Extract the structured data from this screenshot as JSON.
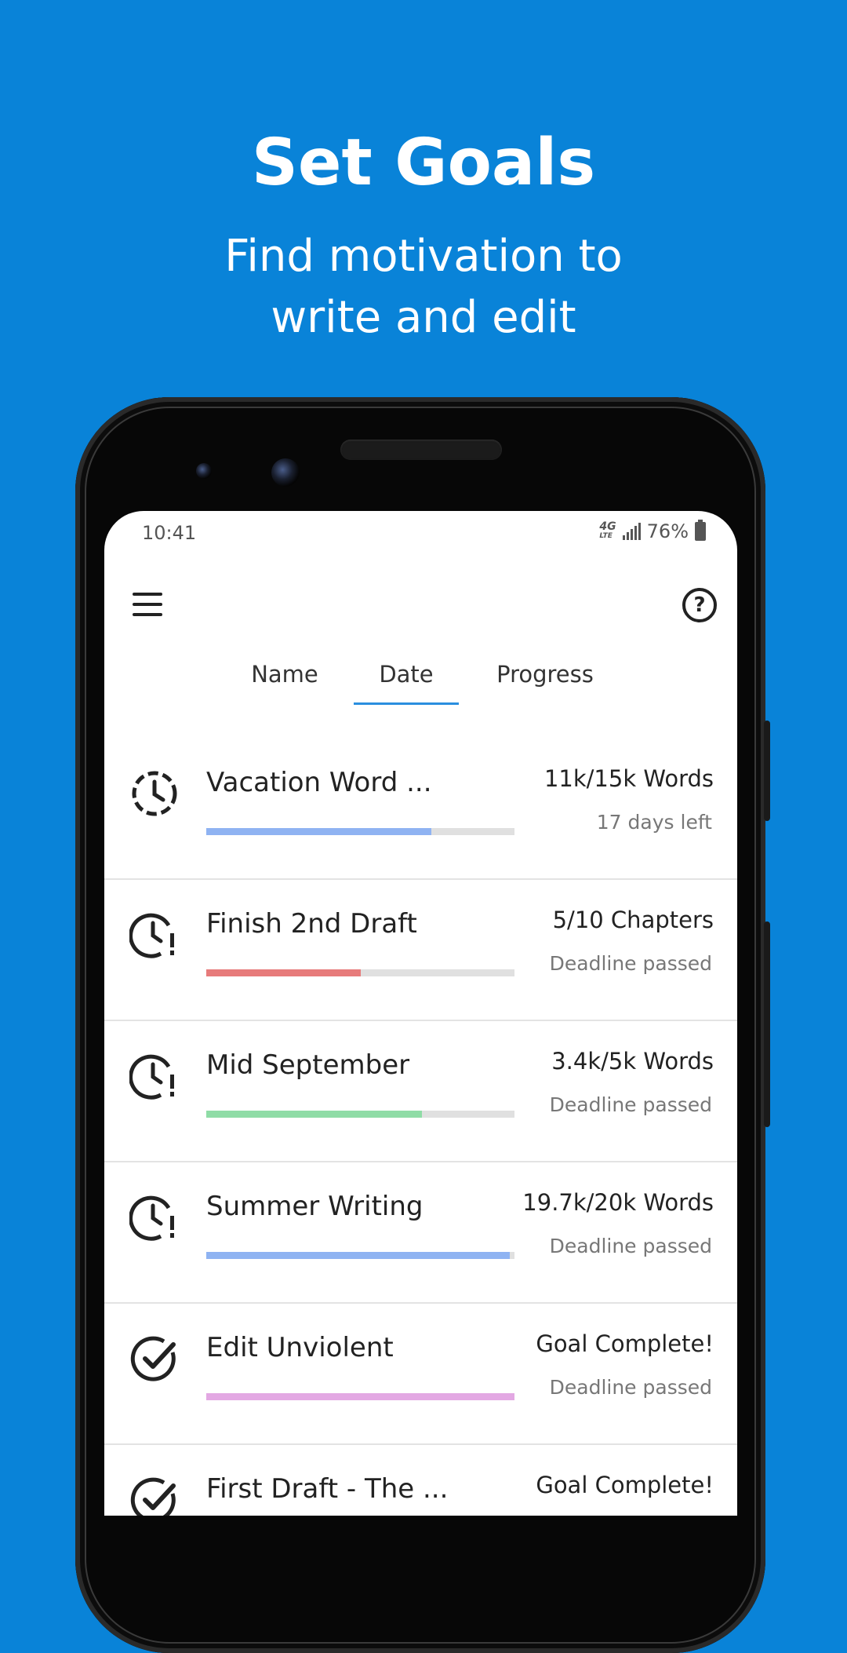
{
  "promo": {
    "title": "Set Goals",
    "subtitle_line1": "Find motivation to",
    "subtitle_line2": "write and edit"
  },
  "status_bar": {
    "time": "10:41",
    "network": "4G",
    "network_sub": "LTE",
    "battery": "76%"
  },
  "tabs": [
    {
      "label": "Name",
      "active": false
    },
    {
      "label": "Date",
      "active": true
    },
    {
      "label": "Progress",
      "active": false
    }
  ],
  "goals": [
    {
      "title": "Vacation Word ...",
      "count": "11k/15k Words",
      "status": "17 days left",
      "progress": 0.73,
      "color": "#8fb3f2",
      "icon": "clock-dashed-icon"
    },
    {
      "title": "Finish 2nd Draft",
      "count": "5/10 Chapters",
      "status": "Deadline passed",
      "progress": 0.5,
      "color": "#e77b7b",
      "icon": "clock-alert-icon"
    },
    {
      "title": "Mid September",
      "count": "3.4k/5k Words",
      "status": "Deadline passed",
      "progress": 0.7,
      "color": "#8fdca6",
      "icon": "clock-alert-icon"
    },
    {
      "title": "Summer Writing",
      "count": "19.7k/20k Words",
      "status": "Deadline passed",
      "progress": 0.985,
      "color": "#8fb3f2",
      "icon": "clock-alert-icon"
    },
    {
      "title": "Edit Unviolent",
      "count": "Goal Complete!",
      "status": "Deadline passed",
      "progress": 1.0,
      "color": "#e3a8e3",
      "icon": "check-circle-icon"
    },
    {
      "title": "First Draft - The ...",
      "count": "Goal Complete!",
      "status": "",
      "progress": 1.0,
      "color": "#8fb3f2",
      "icon": "check-circle-icon"
    }
  ]
}
